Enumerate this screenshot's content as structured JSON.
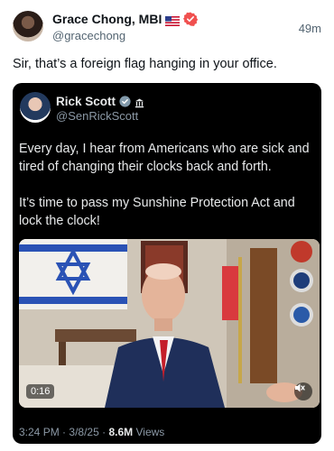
{
  "post": {
    "author": {
      "display_name": "Grace Chong, MBI",
      "handle": "@gracechong",
      "flag_icon": "us-flag-icon",
      "verified_icon": "verified-badge-icon"
    },
    "timestamp": "49m",
    "text": "Sir, that’s a foreign flag hanging in your office."
  },
  "quoted_post": {
    "author": {
      "display_name": "Rick Scott",
      "handle": "@SenRickScott",
      "badge_icon": "gray-verified-badge-icon",
      "affiliation_icon": "government-icon"
    },
    "paragraphs": [
      "Every day, I hear from Americans who are sick and tired of changing their clocks back and forth.",
      "It’s time to pass my Sunshine Protection Act and lock the clock!"
    ],
    "video": {
      "duration": "0:16",
      "mute_icon": "volume-muted-icon"
    },
    "meta": {
      "time": "3:24 PM",
      "date": "3/8/25",
      "views_count": "8.6M",
      "views_label": "Views"
    }
  },
  "colors": {
    "verified": "#f0504f",
    "link_gray": "#536471",
    "card_bg": "#000000"
  }
}
